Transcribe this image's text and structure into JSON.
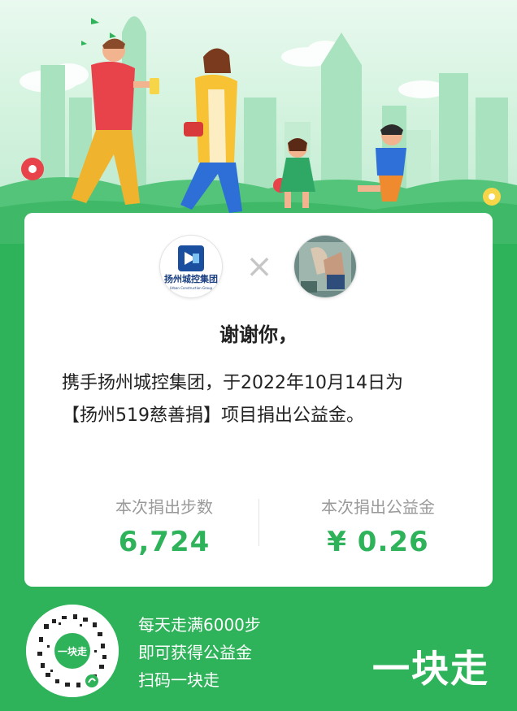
{
  "header": {
    "illustration": "family-walking-city-skyline"
  },
  "card": {
    "partner_logo": "yangzhou-city-holding-logo",
    "partner_logo_text": "扬州城控集团",
    "partner_logo_subtext": "Urban Construction Group",
    "times_symbol": "×",
    "user_avatar": "user-avatar-photo",
    "thanks": "谢谢你，",
    "message_line1": "携手扬州城控集团，于2022年10月14日为",
    "message_line2": "【扬州519慈善捐】项目捐出公益金。",
    "steps_label": "本次捐出步数",
    "steps_value": "6,724",
    "money_label": "本次捐出公益金",
    "money_value": "¥ 0.26"
  },
  "footer": {
    "qr_label": "一块走",
    "line1": "每天走满6000步",
    "line2": "即可获得公益金",
    "line3": "扫码一块走",
    "brand": "一块走"
  },
  "colors": {
    "accent_green": "#2fb35a",
    "background_green": "#2fb35a",
    "card_white": "#ffffff"
  }
}
